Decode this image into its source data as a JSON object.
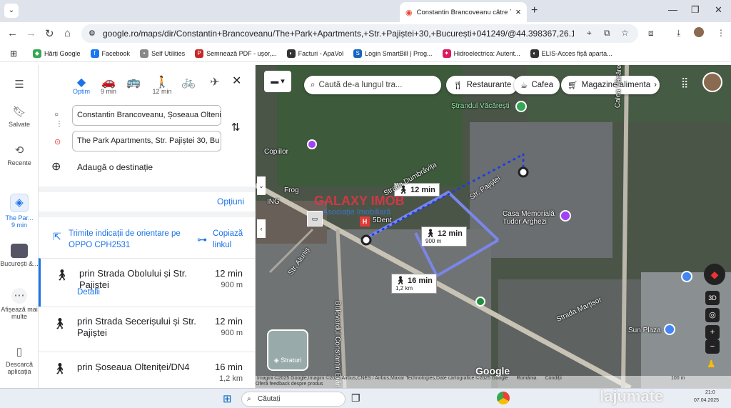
{
  "browser": {
    "tab_title": "Constantin Brancoveanu către The",
    "url": "google.ro/maps/dir/Constantin+Brancoveanu/The+Park+Apartments,+Str.+Pajiștei+30,+București+041249/@44.398367,26.1104332,1043m/da..."
  },
  "bookmarks": [
    {
      "label": "Hărți Google",
      "color": "#34a853",
      "glyph": "◆"
    },
    {
      "label": "Facebook",
      "color": "#1877f2",
      "glyph": "f"
    },
    {
      "label": "Self Utilities",
      "color": "#888888",
      "glyph": "•"
    },
    {
      "label": "Semnează PDF - ușor,...",
      "color": "#c62828",
      "glyph": "P"
    },
    {
      "label": "Facturi - ApaVol",
      "color": "#333333",
      "glyph": "◐"
    },
    {
      "label": "Login SmartBill | Prog...",
      "color": "#1565c0",
      "glyph": "S"
    },
    {
      "label": "Hidroelectrica: Autent...",
      "color": "#d81b60",
      "glyph": "✦"
    },
    {
      "label": "ELIS-Acces fișă aparta...",
      "color": "#333333",
      "glyph": "◐"
    }
  ],
  "rail": {
    "saved": "Salvate",
    "recent": "Recente",
    "trip_title": "The Par...",
    "trip_time": "9 min",
    "bucharest": "București &...",
    "more": "Afișează mai multe",
    "download": "Descarcă aplicația"
  },
  "panel": {
    "modes": [
      {
        "label": "Optim",
        "icon": "◆"
      },
      {
        "label": "9 min",
        "icon": "🚗"
      },
      {
        "label": "",
        "icon": "🚌"
      },
      {
        "label": "12 min",
        "icon": "🚶"
      },
      {
        "label": "",
        "icon": "🚲"
      },
      {
        "label": "",
        "icon": "✈"
      }
    ],
    "origin": "Constantin Brancoveanu, Șoseaua Olteni",
    "destination": "The Park Apartments, Str. Pajiștei 30, Bu",
    "add_destination": "Adaugă o destinație",
    "options": "Opțiuni",
    "send_text": "Trimite indicații de orientare pe OPPO CPH2531",
    "copy_link": "Copiază linkul",
    "routes": [
      {
        "name": "prin Strada Obolului și Str. Pajiștei",
        "time": "12 min",
        "distance": "900 m",
        "details": "Detalii"
      },
      {
        "name": "prin Strada Secerișului și Str. Pajiștei",
        "time": "12 min",
        "distance": "900 m"
      },
      {
        "name": "prin Șoseaua Olteniței/DN4",
        "time": "16 min",
        "distance": "1,2 km"
      }
    ]
  },
  "map": {
    "search_placeholder": "Caută de-a lungul tra...",
    "chips": [
      "Restaurante",
      "Cafea",
      "Magazine alimenta"
    ],
    "labels": [
      {
        "time": "12 min",
        "dist": ""
      },
      {
        "time": "12 min",
        "dist": "900 m"
      },
      {
        "time": "16 min",
        "dist": "1,2 km"
      }
    ],
    "places": [
      "Ștrandul Văcărești",
      "Casa Memorială Tudor Arghezi",
      "Sun Plaza",
      "Calea Văcărești",
      "Bulevardul Constantin Brâncoveanu",
      "Str. Aluniș",
      "Strada Dumbrăvița",
      "Str. Pajiștei",
      "Strada Marțișor",
      "Frog",
      "ING",
      "GALAXY IMOB",
      "Asociație Imobiliară",
      "Copiilor",
      "5Dent"
    ],
    "layers": "Straturi",
    "attribution": "Imagini ©2025 Google,Imagini ©2025 Airbus,CNES / Airbus,Maxar Technologies,Date cartografice ©2025 Google",
    "romania": "România",
    "conditions": "Condiții",
    "feedback": "Oferă feedback despre produs",
    "scale": "100 m",
    "brand": "Google",
    "btn_3d": "3D"
  },
  "taskbar": {
    "search": "Căutați",
    "time": "21:0",
    "date": "07.04.2025",
    "watermark": "lajumate"
  }
}
